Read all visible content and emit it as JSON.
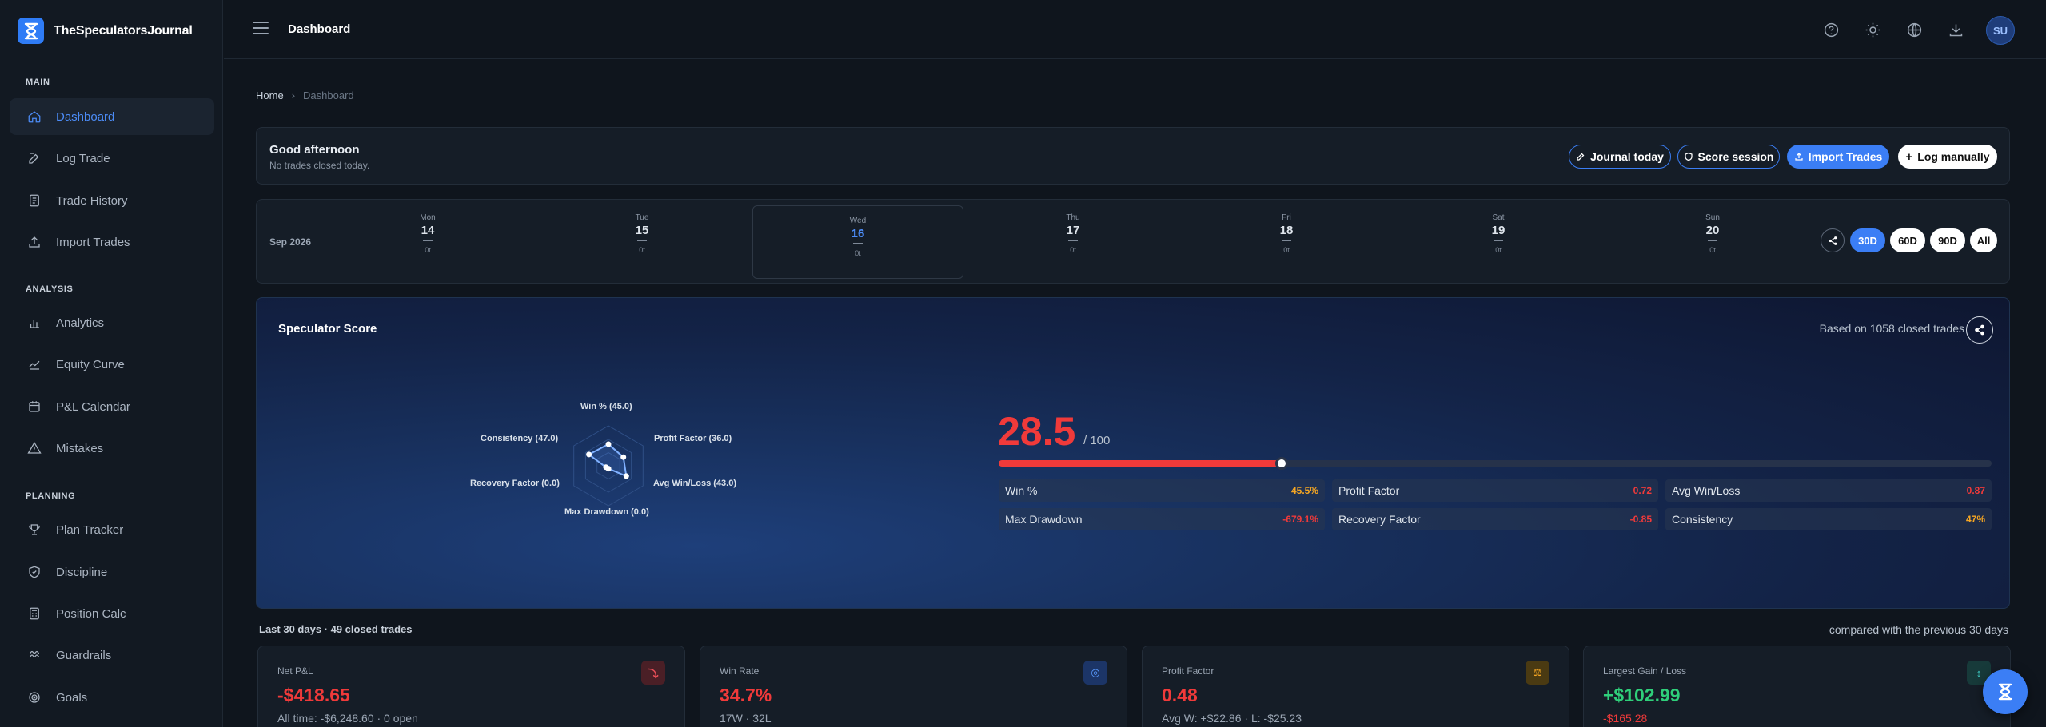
{
  "brand": {
    "name": "TheSpeculatorsJournal"
  },
  "sidebar": {
    "sections": [
      "MAIN",
      "ANALYSIS",
      "PLANNING"
    ],
    "items": [
      {
        "label": "Dashboard",
        "icon": "home-icon"
      },
      {
        "label": "Log Trade",
        "icon": "edit-icon"
      },
      {
        "label": "Trade History",
        "icon": "history-icon"
      },
      {
        "label": "Import Trades",
        "icon": "upload-icon"
      },
      {
        "label": "Analytics",
        "icon": "bar-chart-icon"
      },
      {
        "label": "Equity Curve",
        "icon": "line-chart-icon"
      },
      {
        "label": "P&L Calendar",
        "icon": "calendar-icon"
      },
      {
        "label": "Mistakes",
        "icon": "warning-icon"
      },
      {
        "label": "Plan Tracker",
        "icon": "trophy-icon"
      },
      {
        "label": "Discipline",
        "icon": "shield-icon"
      },
      {
        "label": "Position Calc",
        "icon": "calculator-icon"
      },
      {
        "label": "Guardrails",
        "icon": "guardrail-icon"
      },
      {
        "label": "Goals",
        "icon": "target-icon"
      }
    ]
  },
  "topbar": {
    "title": "Dashboard",
    "avatar": "SU"
  },
  "breadcrumb": {
    "home": "Home",
    "current": "Dashboard"
  },
  "greeting": {
    "title": "Good afternoon",
    "subtitle": "No trades closed today.",
    "buttons": [
      "Journal today",
      "Score session",
      "Import Trades",
      "Log manually"
    ]
  },
  "week": {
    "month": "Sep 2026",
    "days": [
      {
        "name": "Mon",
        "date": "14",
        "trades": "0t"
      },
      {
        "name": "Tue",
        "date": "15",
        "trades": "0t"
      },
      {
        "name": "Wed",
        "date": "16",
        "trades": "0t"
      },
      {
        "name": "Thu",
        "date": "17",
        "trades": "0t"
      },
      {
        "name": "Fri",
        "date": "18",
        "trades": "0t"
      },
      {
        "name": "Sat",
        "date": "19",
        "trades": "0t"
      },
      {
        "name": "Sun",
        "date": "20",
        "trades": "0t"
      }
    ],
    "ranges": [
      "30D",
      "60D",
      "90D",
      "All"
    ]
  },
  "score": {
    "title": "Speculator Score",
    "based_on": "Based on 1058 closed trades",
    "value": "28.5",
    "out_of": "/ 100",
    "fraction": 0.285,
    "radar_labels": [
      "Win % (45.0)",
      "Profit Factor (36.0)",
      "Avg Win/Loss (43.0)",
      "Max Drawdown (0.0)",
      "Recovery Factor (0.0)",
      "Consistency (47.0)"
    ],
    "radar_values": [
      45,
      36,
      43,
      0,
      0,
      47
    ],
    "metrics": [
      {
        "label": "Win %",
        "value": "45.5%",
        "color": "#f5a623"
      },
      {
        "label": "Profit Factor",
        "value": "0.72",
        "color": "#f03a3a"
      },
      {
        "label": "Avg Win/Loss",
        "value": "0.87",
        "color": "#f03a3a"
      },
      {
        "label": "Max Drawdown",
        "value": "-679.1%",
        "color": "#f03a3a"
      },
      {
        "label": "Recovery Factor",
        "value": "-0.85",
        "color": "#f03a3a"
      },
      {
        "label": "Consistency",
        "value": "47%",
        "color": "#f5a623"
      }
    ]
  },
  "period": {
    "left": "Last 30 days · 49 closed trades",
    "right": "compared with the previous 30 days"
  },
  "stats": [
    {
      "label": "Net P&L",
      "value": "-$418.65",
      "sub": "All time: -$6,248.60 · 0 open",
      "value_color": "#f03a3a",
      "icon": "trend-down-icon"
    },
    {
      "label": "Win Rate",
      "value": "34.7%",
      "sub": "17W · 32L",
      "value_color": "#f03a3a",
      "icon": "target-icon"
    },
    {
      "label": "Profit Factor",
      "value": "0.48",
      "sub": "Avg W: +$22.86 · L: -$25.23",
      "value_color": "#f03a3a",
      "icon": "scale-icon"
    },
    {
      "label": "Largest Gain / Loss",
      "value": "+$102.99",
      "sub": "-$165.28",
      "value_color": "#2fcf7a",
      "icon": "arrows-vertical-icon"
    }
  ]
}
